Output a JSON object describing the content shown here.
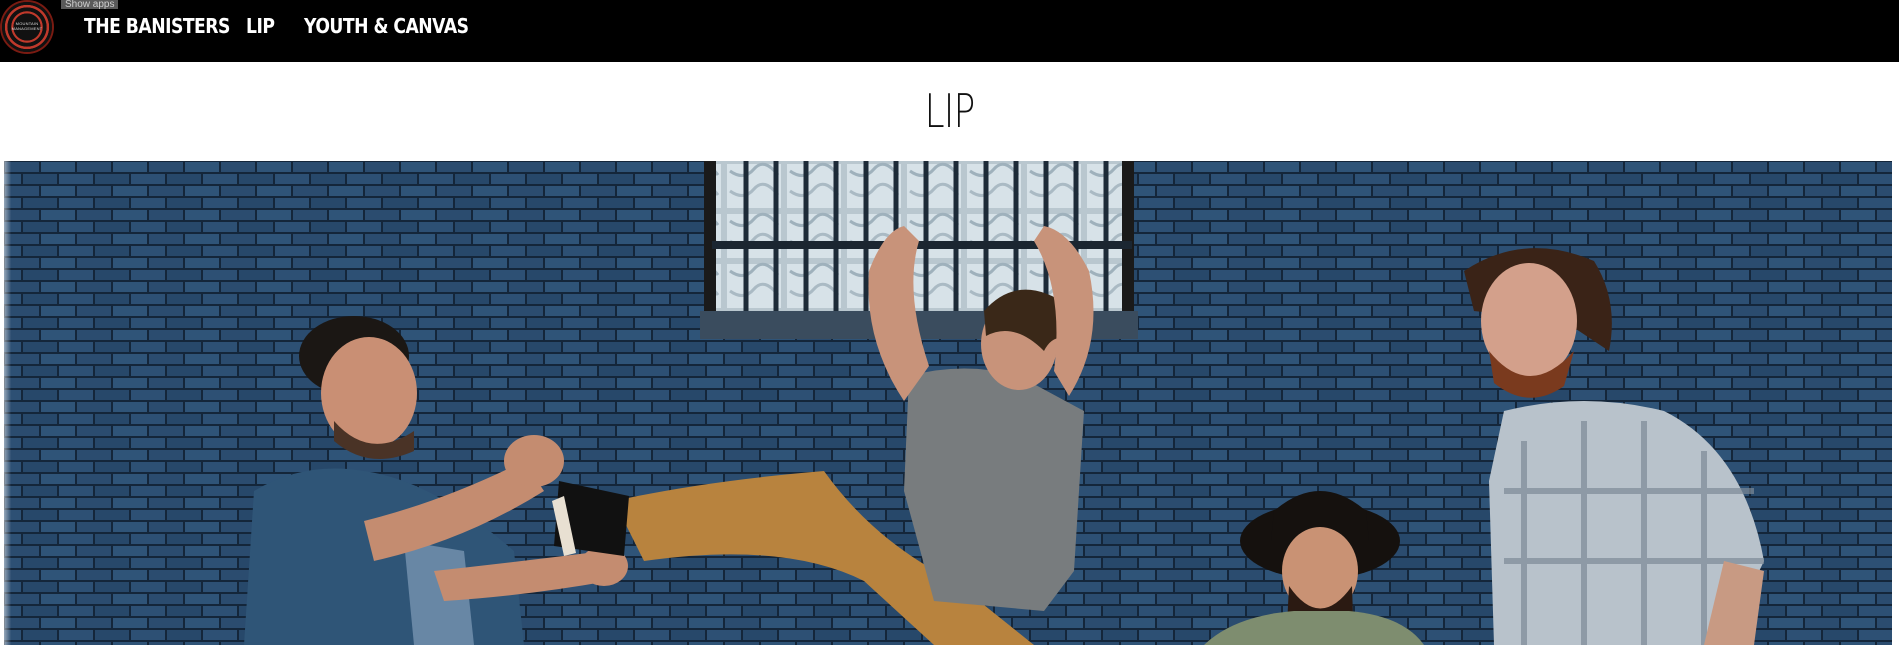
{
  "header": {
    "logo_text": "MOUNTAIN MANAGEMENT",
    "tooltip": "Show apps",
    "nav": [
      {
        "label": "THE BANISTERS"
      },
      {
        "label": "LIP"
      },
      {
        "label": "YOUTH & CANVAS"
      }
    ]
  },
  "main": {
    "title": "LIP",
    "hero_alt": "Band photo of four men posing against a blue brick wall"
  },
  "colors": {
    "topbar": "#000000",
    "nav_text": "#ffffff",
    "wall": "#2a4a6b"
  }
}
